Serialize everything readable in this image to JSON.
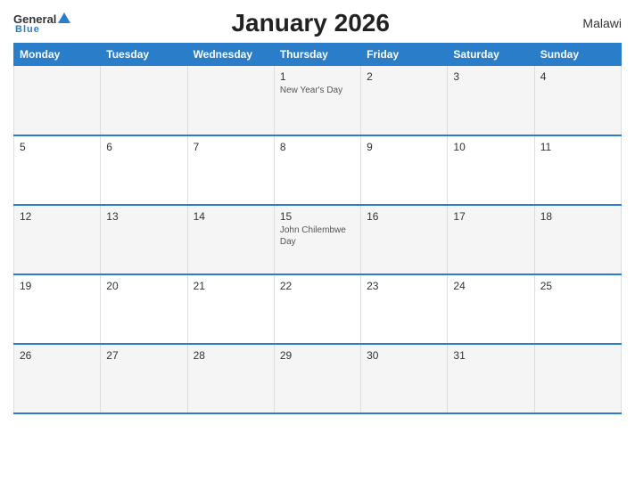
{
  "header": {
    "title": "January 2026",
    "country": "Malawi",
    "logo_general": "General",
    "logo_blue": "Blue"
  },
  "days_of_week": [
    "Monday",
    "Tuesday",
    "Wednesday",
    "Thursday",
    "Friday",
    "Saturday",
    "Sunday"
  ],
  "weeks": [
    [
      {
        "day": "",
        "holiday": ""
      },
      {
        "day": "",
        "holiday": ""
      },
      {
        "day": "",
        "holiday": ""
      },
      {
        "day": "1",
        "holiday": "New Year's Day"
      },
      {
        "day": "2",
        "holiday": ""
      },
      {
        "day": "3",
        "holiday": ""
      },
      {
        "day": "4",
        "holiday": ""
      }
    ],
    [
      {
        "day": "5",
        "holiday": ""
      },
      {
        "day": "6",
        "holiday": ""
      },
      {
        "day": "7",
        "holiday": ""
      },
      {
        "day": "8",
        "holiday": ""
      },
      {
        "day": "9",
        "holiday": ""
      },
      {
        "day": "10",
        "holiday": ""
      },
      {
        "day": "11",
        "holiday": ""
      }
    ],
    [
      {
        "day": "12",
        "holiday": ""
      },
      {
        "day": "13",
        "holiday": ""
      },
      {
        "day": "14",
        "holiday": ""
      },
      {
        "day": "15",
        "holiday": "John Chilembwe Day"
      },
      {
        "day": "16",
        "holiday": ""
      },
      {
        "day": "17",
        "holiday": ""
      },
      {
        "day": "18",
        "holiday": ""
      }
    ],
    [
      {
        "day": "19",
        "holiday": ""
      },
      {
        "day": "20",
        "holiday": ""
      },
      {
        "day": "21",
        "holiday": ""
      },
      {
        "day": "22",
        "holiday": ""
      },
      {
        "day": "23",
        "holiday": ""
      },
      {
        "day": "24",
        "holiday": ""
      },
      {
        "day": "25",
        "holiday": ""
      }
    ],
    [
      {
        "day": "26",
        "holiday": ""
      },
      {
        "day": "27",
        "holiday": ""
      },
      {
        "day": "28",
        "holiday": ""
      },
      {
        "day": "29",
        "holiday": ""
      },
      {
        "day": "30",
        "holiday": ""
      },
      {
        "day": "31",
        "holiday": ""
      },
      {
        "day": "",
        "holiday": ""
      }
    ]
  ]
}
